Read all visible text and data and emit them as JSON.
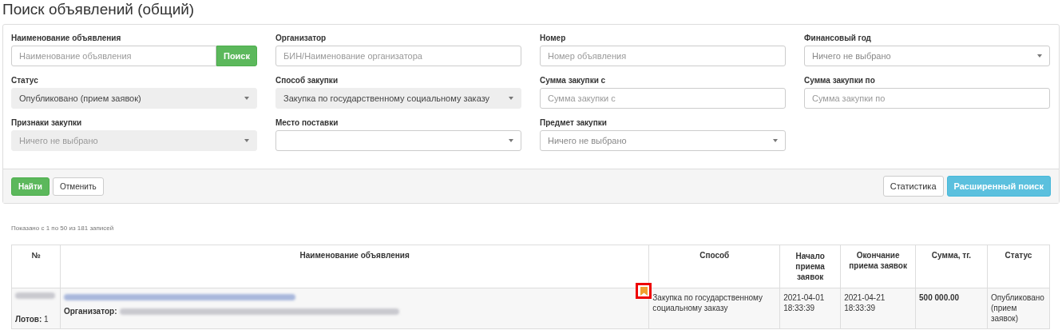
{
  "title": "Поиск объявлений (общий)",
  "filters": [
    {
      "kind": "input-button",
      "label": "Наименование объявления",
      "placeholder": "Наименование объявления",
      "button": "Поиск"
    },
    {
      "kind": "input",
      "label": "Организатор",
      "placeholder": "БИН/Наименование организатора"
    },
    {
      "kind": "input",
      "label": "Номер",
      "placeholder": "Номер объявления"
    },
    {
      "kind": "select",
      "label": "Финансовый год",
      "value": "Ничего не выбрано",
      "shaded": false,
      "disabled": false,
      "placeholder_style": true
    },
    {
      "kind": "select",
      "label": "Статус",
      "value": "Опубликовано (прием заявок)",
      "shaded": true,
      "disabled": false,
      "placeholder_style": false
    },
    {
      "kind": "select",
      "label": "Способ закупки",
      "value": "Закупка по государственному социальному заказу",
      "shaded": true,
      "disabled": false,
      "placeholder_style": false
    },
    {
      "kind": "input",
      "label": "Сумма закупки с",
      "placeholder": "Сумма закупки с"
    },
    {
      "kind": "input",
      "label": "Сумма закупки по",
      "placeholder": "Сумма закупки по"
    },
    {
      "kind": "select",
      "label": "Признаки закупки",
      "value": "Ничего не выбрано",
      "shaded": true,
      "disabled": true,
      "placeholder_style": true
    },
    {
      "kind": "select",
      "label": "Место поставки",
      "shaded": false
    },
    {
      "kind": "select",
      "label": "Предмет закупки",
      "value": "Ничего не выбрано",
      "shaded": false,
      "disabled": false,
      "placeholder_style": true
    }
  ],
  "footer": {
    "left_buttons": [
      {
        "label": "Найти",
        "kind": "success"
      },
      {
        "label": "Отменить",
        "kind": "default"
      }
    ],
    "right_buttons": [
      {
        "label": "Статистика",
        "kind": "default"
      },
      {
        "label": "Расширенный поиск",
        "kind": "info"
      }
    ]
  },
  "records_info": "Показано с 1 по 50 из 181 записей",
  "table": {
    "columns": [
      "№",
      "Наименование объявления",
      "Способ",
      "Начало приема заявок",
      "Окончание приема заявок",
      "Сумма, тг.",
      "Статус"
    ],
    "rows": [
      {
        "lots_label": "Лотов:",
        "lots": "1",
        "organizer_label": "Организатор:",
        "bookmarked": true,
        "method": "Закупка по государственному социальному заказу",
        "start": "2021-04-01 18:33:39",
        "end": "2021-04-21 18:33:39",
        "sum": "500 000.00",
        "status": "Опубликовано (прием заявок)"
      }
    ]
  }
}
